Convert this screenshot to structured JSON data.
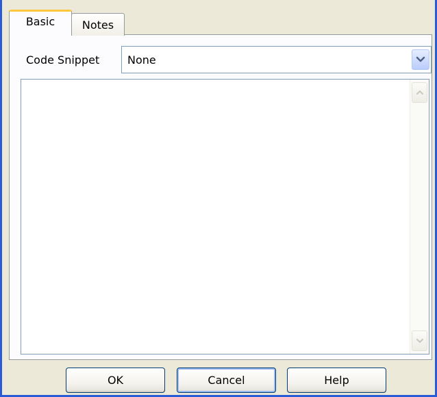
{
  "tabs": {
    "basic": "Basic",
    "notes": "Notes"
  },
  "form": {
    "code_snippet_label": "Code Snippet",
    "code_snippet_value": "None",
    "text_area_value": ""
  },
  "buttons": {
    "ok": "OK",
    "cancel": "Cancel",
    "help": "Help"
  },
  "icons": {
    "dropdown": "chevron-down-icon",
    "scroll_up": "scroll-up-arrow-icon",
    "scroll_down": "scroll-down-arrow-icon"
  },
  "colors": {
    "window_border": "#2a5bd7",
    "dialog_background": "#ece9d8",
    "active_tab_highlight": "#ffc83c",
    "button_border": "#003c74"
  }
}
